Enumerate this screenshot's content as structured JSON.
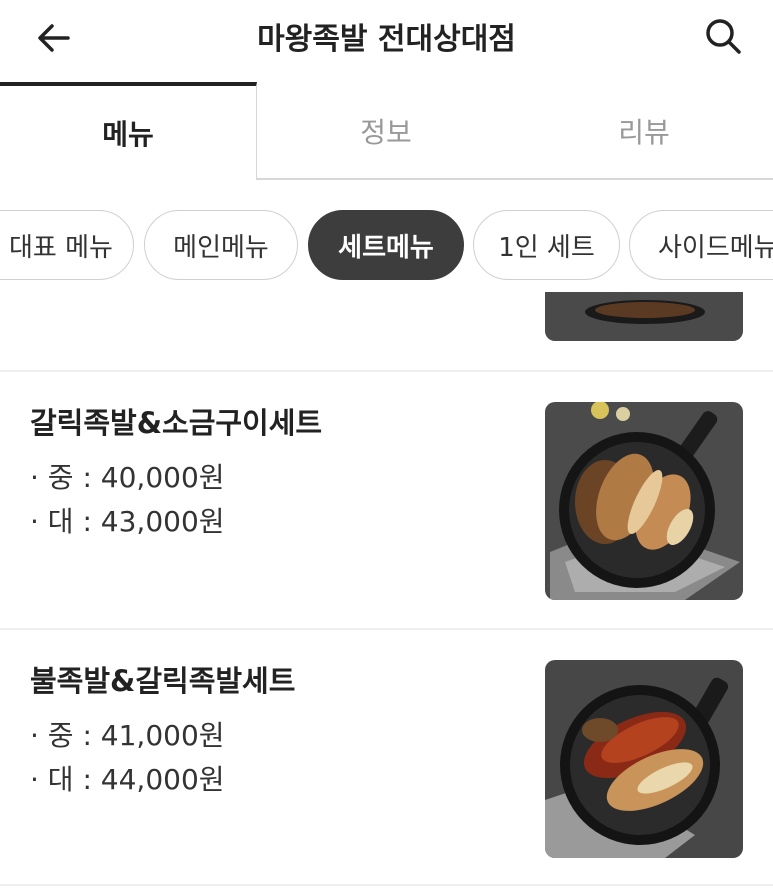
{
  "header": {
    "title": "마왕족발 전대상대점",
    "back_icon": "arrow-left-icon",
    "search_icon": "search-icon"
  },
  "tabs": [
    {
      "label": "메뉴",
      "active": true
    },
    {
      "label": "정보",
      "active": false
    },
    {
      "label": "리뷰",
      "active": false
    }
  ],
  "categories": [
    {
      "label": "대표 메뉴",
      "active": false
    },
    {
      "label": "메인메뉴",
      "active": false
    },
    {
      "label": "세트메뉴",
      "active": true
    },
    {
      "label": "1인 세트",
      "active": false
    },
    {
      "label": "사이드메뉴",
      "active": false
    }
  ],
  "menu_items": [
    {
      "name": "갈릭족발&소금구이세트",
      "prices": [
        "· 중 : 40,000원",
        "· 대 : 43,000원"
      ]
    },
    {
      "name": "불족발&갈릭족발세트",
      "prices": [
        "· 중 : 41,000원",
        "· 대 : 44,000원"
      ]
    }
  ],
  "colors": {
    "text": "#222222",
    "muted": "#999999",
    "chip_active_bg": "#3d3d3d",
    "border": "#d7d7d7"
  }
}
